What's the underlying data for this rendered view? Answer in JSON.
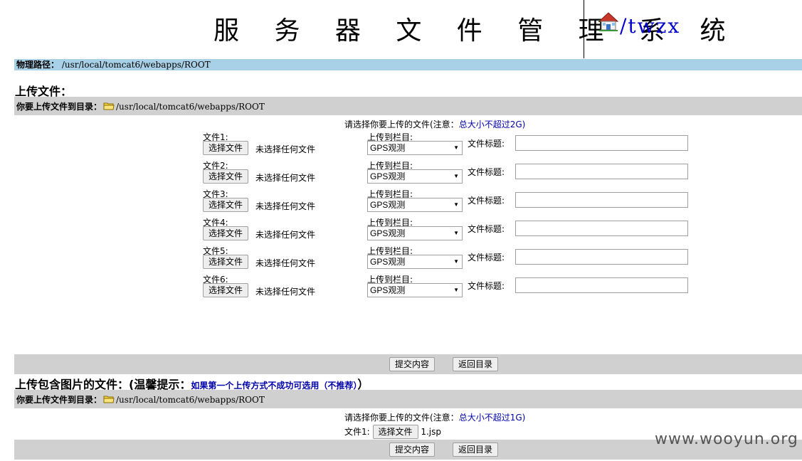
{
  "header": {
    "title": "服 务 器 文 件 管 理 系 统",
    "home_link": "/twzx",
    "home_icon": "house-icon"
  },
  "physical_path": {
    "label": "物理路径：",
    "value": "/usr/local/tomcat6/webapps/ROOT"
  },
  "upload_section": {
    "heading": "上传文件：",
    "target_label": "你要上传文件到目录：",
    "target_path": "/usr/local/tomcat6/webapps/ROOT",
    "notice_prefix": "请选择你要上传的文件(注意：",
    "notice_em": "总大小不超过2G",
    "notice_suffix": ")",
    "rows": [
      {
        "file_label": "文件1:",
        "button": "选择文件",
        "no_file": "未选择任何文件",
        "column_label": "上传到栏目:",
        "column_value": "GPS观测",
        "title_label": "文件标题:",
        "title_value": ""
      },
      {
        "file_label": "文件2:",
        "button": "选择文件",
        "no_file": "未选择任何文件",
        "column_label": "上传到栏目:",
        "column_value": "GPS观测",
        "title_label": "文件标题:",
        "title_value": ""
      },
      {
        "file_label": "文件3:",
        "button": "选择文件",
        "no_file": "未选择任何文件",
        "column_label": "上传到栏目:",
        "column_value": "GPS观测",
        "title_label": "文件标题:",
        "title_value": ""
      },
      {
        "file_label": "文件4:",
        "button": "选择文件",
        "no_file": "未选择任何文件",
        "column_label": "上传到栏目:",
        "column_value": "GPS观测",
        "title_label": "文件标题:",
        "title_value": ""
      },
      {
        "file_label": "文件5:",
        "button": "选择文件",
        "no_file": "未选择任何文件",
        "column_label": "上传到栏目:",
        "column_value": "GPS观测",
        "title_label": "文件标题:",
        "title_value": ""
      },
      {
        "file_label": "文件6:",
        "button": "选择文件",
        "no_file": "未选择任何文件",
        "column_label": "上传到栏目:",
        "column_value": "GPS观测",
        "title_label": "文件标题:",
        "title_value": ""
      }
    ],
    "submit_label": "提交内容",
    "back_label": "返回目录"
  },
  "image_upload_section": {
    "heading": "上传包含图片的文件：(温馨提示：",
    "tip": "如果第一个上传方式不成功可选用（不推荐）",
    "heading_end": "）",
    "target_label": "你要上传文件到目录：",
    "target_path": "/usr/local/tomcat6/webapps/ROOT",
    "notice_prefix": "请选择你要上传的文件(注意：",
    "notice_em": "总大小不超过1G",
    "notice_suffix": ")",
    "file_label": "文件1:",
    "button": "选择文件",
    "chosen_file": "1.jsp",
    "submit_label": "提交内容",
    "back_label": "返回目录"
  },
  "watermark": "www.wooyun.org",
  "colors": {
    "path_bar": "#a8d0e6",
    "gray_bar": "#d0d0d0",
    "link": "#0000cc"
  }
}
